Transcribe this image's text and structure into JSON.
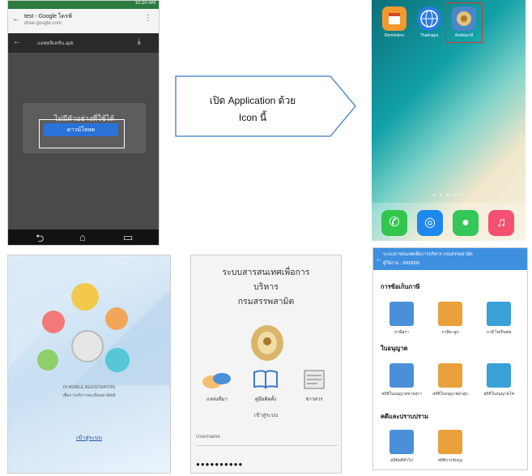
{
  "panel_browser": {
    "status_time": "10:20 AM",
    "tab_title": "test - Google ไดรฟ์",
    "tab_url": "drive.google.com",
    "file_name": "แอพพลิเคชัน.apk",
    "dialog_message": "ไม่มีตัวอย่างที่ใช้ได้",
    "open_button_label": "ดาวน์โหลด",
    "nav_back": "⮌",
    "nav_home": "⌂",
    "nav_recent": "▭"
  },
  "callout": {
    "line1": "เปิด Application ด้วย",
    "line2": "Icon นี้"
  },
  "panel_home": {
    "apps": [
      {
        "label": "Reminders",
        "color": "#f39a2e",
        "icon": "calendar-icon"
      },
      {
        "label": "Thaimapa",
        "color": "#2a7be4",
        "icon": "globe-icon"
      },
      {
        "label": "Andrew M",
        "color": "#4b86c9",
        "icon": "app-emblem-icon"
      }
    ],
    "dock": [
      {
        "icon": "phone-icon",
        "color": "#33c64f",
        "glyph": "✆"
      },
      {
        "icon": "safari-icon",
        "color": "#1e88ef",
        "glyph": "◎"
      },
      {
        "icon": "messages-icon",
        "color": "#34c759",
        "glyph": "●"
      },
      {
        "icon": "music-icon",
        "color": "#f45172",
        "glyph": "♫"
      }
    ],
    "dots": "• • • • •"
  },
  "panel_splash": {
    "line1": "DI MOBILE REGISTRATION",
    "line2": "เพื่อการบริการทะเบียนพาณิชย์",
    "start_link": "เข้าสู่ระบบ"
  },
  "panel_login": {
    "title_line1": "ระบบสารสนเทศเพื่อการ",
    "title_line2": "บริหาร",
    "title_line3": "กรมสรรพสามิต",
    "menu": [
      {
        "label": "แหล่งที่มา",
        "icon": "hands-icon"
      },
      {
        "label": "คู่มือติดตั้ง",
        "icon": "book-icon"
      },
      {
        "label": "ข่าวสาร",
        "icon": "news-icon"
      }
    ],
    "login_label": "เข้าสู่ระบบ",
    "username_placeholder": "Username",
    "password_value": "●●●●●●●●●●"
  },
  "panel_menu": {
    "header_line1": "ระบบสารสนเทศเพื่อการบริหาร กรมสรรพสามิต",
    "header_line2": "ผู้ใช้งาน : 0000000",
    "sections": [
      {
        "title": "การข้อเก็บภาษี",
        "items": [
          {
            "label": "ภาษีสุรา",
            "color": "#4a8fd8"
          },
          {
            "label": "ภาษียาสูบ",
            "color": "#e8a03a"
          },
          {
            "label": "ภาษี ไพ่/Pasta",
            "color": "#3aa0d8"
          }
        ]
      },
      {
        "title": "ใบอนุญาต",
        "items": [
          {
            "label": "สถิติใบอนุญาตขายสุรา",
            "color": "#4a8fd8"
          },
          {
            "label": "สถิติใบอนุญาตยาสูบ",
            "color": "#e8a03a"
          },
          {
            "label": "สถิติใบอนุญาตไพ่",
            "color": "#3aa0d8"
          }
        ]
      },
      {
        "title": "คดีและปราบปราม",
        "items": [
          {
            "label": "สถิติคดีทั่วไป",
            "color": "#4a8fd8"
          },
          {
            "label": "สถิติการจับกุม",
            "color": "#e8a03a"
          }
        ]
      }
    ]
  }
}
